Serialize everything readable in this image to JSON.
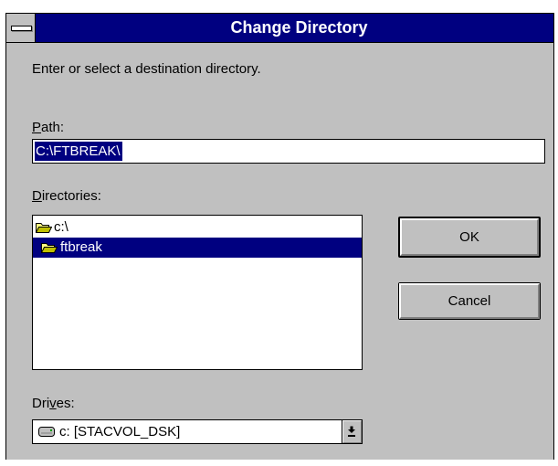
{
  "window": {
    "title": "Change Directory"
  },
  "prompt": "Enter or select a destination directory.",
  "path": {
    "label_mnemonic": "P",
    "label_rest": "ath:",
    "value": "C:\\FTBREAK\\"
  },
  "directories": {
    "label_mnemonic": "D",
    "label_rest": "irectories:",
    "items": [
      {
        "label": "c:\\",
        "icon": "open-folder-icon",
        "selected": false
      },
      {
        "label": "ftbreak",
        "icon": "open-folder-icon",
        "selected": true
      }
    ]
  },
  "buttons": {
    "ok": "OK",
    "cancel": "Cancel"
  },
  "drives": {
    "label_pre": "Dri",
    "label_mnemonic": "v",
    "label_post": "es:",
    "selected": "c: [STACVOL_DSK]",
    "icon": "hard-drive-icon"
  },
  "colors": {
    "titlebar": "#000080",
    "dialog_face": "#c0c0c0",
    "selection": "#000080"
  }
}
